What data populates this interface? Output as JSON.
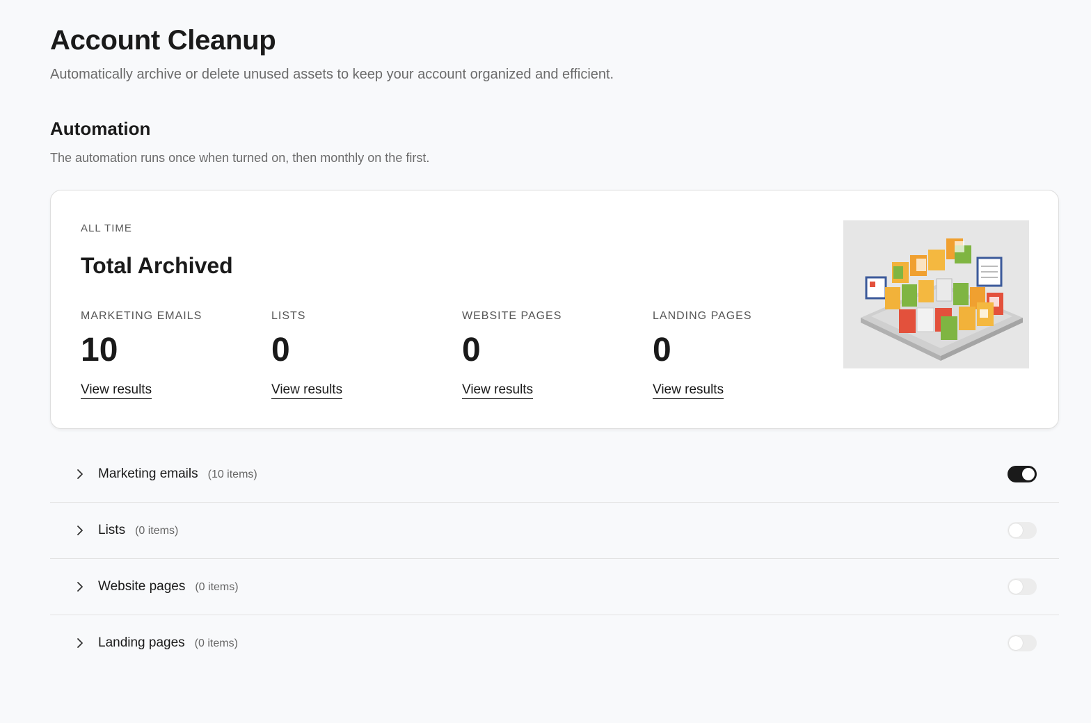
{
  "header": {
    "title": "Account Cleanup",
    "subtitle": "Automatically archive or delete unused assets to keep your account organized and efficient."
  },
  "automation": {
    "title": "Automation",
    "description": "The automation runs once when turned on, then monthly on the first."
  },
  "summary": {
    "eyebrow": "ALL TIME",
    "title": "Total Archived",
    "stats": [
      {
        "label": "MARKETING EMAILS",
        "value": "10",
        "link": "View results"
      },
      {
        "label": "LISTS",
        "value": "0",
        "link": "View results"
      },
      {
        "label": "WEBSITE PAGES",
        "value": "0",
        "link": "View results"
      },
      {
        "label": "LANDING PAGES",
        "value": "0",
        "link": "View results"
      }
    ],
    "illustration_icon": "archived-folders-illustration"
  },
  "asset_types": [
    {
      "label": "Marketing emails",
      "count": "(10 items)",
      "enabled": true
    },
    {
      "label": "Lists",
      "count": "(0 items)",
      "enabled": false
    },
    {
      "label": "Website pages",
      "count": "(0 items)",
      "enabled": false
    },
    {
      "label": "Landing pages",
      "count": "(0 items)",
      "enabled": false
    }
  ],
  "colors": {
    "background": "#f8f9fb",
    "toggle_on": "#1a1a1a",
    "toggle_off": "#ececec"
  }
}
